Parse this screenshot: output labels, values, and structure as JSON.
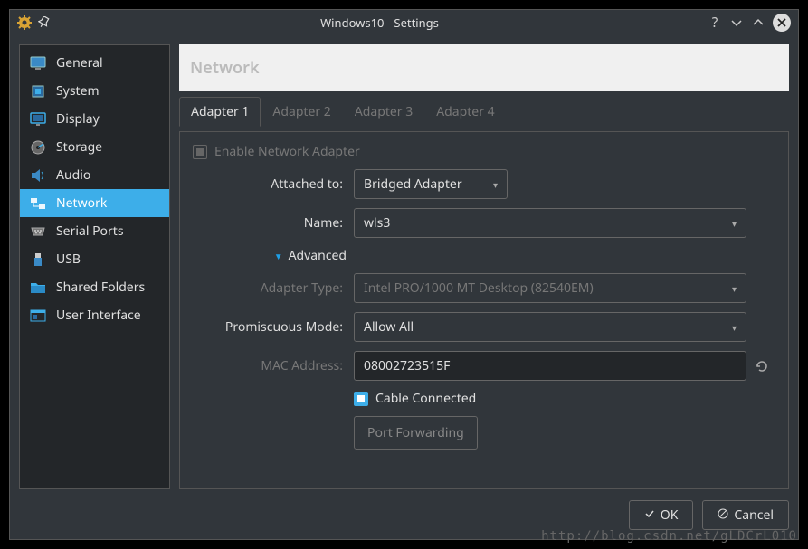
{
  "window": {
    "title": "Windows10 - Settings"
  },
  "sidebar": {
    "items": [
      {
        "label": "General"
      },
      {
        "label": "System"
      },
      {
        "label": "Display"
      },
      {
        "label": "Storage"
      },
      {
        "label": "Audio"
      },
      {
        "label": "Network"
      },
      {
        "label": "Serial Ports"
      },
      {
        "label": "USB"
      },
      {
        "label": "Shared Folders"
      },
      {
        "label": "User Interface"
      }
    ],
    "selected_index": 5
  },
  "content": {
    "header": "Network",
    "tabs": [
      {
        "label": "Adapter 1"
      },
      {
        "label": "Adapter 2"
      },
      {
        "label": "Adapter 3"
      },
      {
        "label": "Adapter 4"
      }
    ],
    "active_tab": 0,
    "enable_adapter": {
      "label": "Enable Network Adapter",
      "checked": true,
      "disabled": true
    },
    "attached_to": {
      "label": "Attached to:",
      "value": "Bridged Adapter"
    },
    "name": {
      "label": "Name:",
      "value": "wls3"
    },
    "advanced": {
      "label": "Advanced",
      "expanded": true
    },
    "adapter_type": {
      "label": "Adapter Type:",
      "value": "Intel PRO/1000 MT Desktop (82540EM)",
      "disabled": true
    },
    "promiscuous": {
      "label": "Promiscuous Mode:",
      "value": "Allow All"
    },
    "mac": {
      "label": "MAC Address:",
      "value": "08002723515F"
    },
    "cable": {
      "label": "Cable Connected",
      "checked": true
    },
    "port_forwarding": {
      "label": "Port Forwarding",
      "disabled": true
    }
  },
  "footer": {
    "ok": "OK",
    "cancel": "Cancel"
  },
  "watermark": "http://blog.csdn.net/gLDCrL010"
}
